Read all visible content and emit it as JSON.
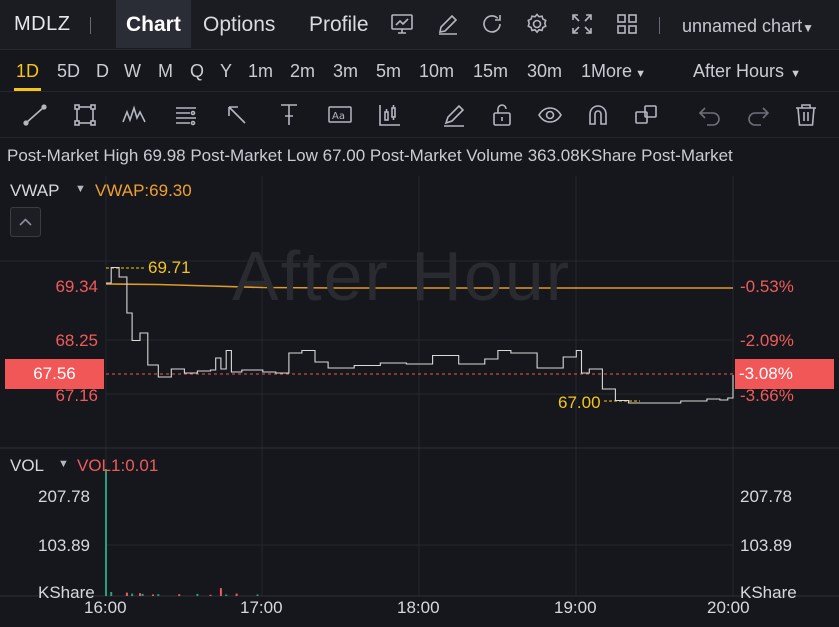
{
  "header": {
    "symbol": "MDLZ",
    "tabs": [
      {
        "label": "Chart",
        "active": true
      },
      {
        "label": "Options",
        "active": false
      },
      {
        "label": "Profile",
        "active": false
      }
    ],
    "icons": [
      "monitor-chart-icon",
      "pen-edit-icon",
      "refresh-icon",
      "gear-icon",
      "fullscreen-icon",
      "grid-layout-icon"
    ],
    "chart_name": "unnamed chart"
  },
  "periods": {
    "items": [
      "1D",
      "5D",
      "D",
      "W",
      "M",
      "Q",
      "Y",
      "1m",
      "2m",
      "3m",
      "5m",
      "10m",
      "15m",
      "30m"
    ],
    "active": "1D",
    "more_label": "1More",
    "session_label": "After Hours"
  },
  "toolbar": {
    "tools": [
      "trend-line-icon",
      "rectangle-icon",
      "pattern-wave-icon",
      "fibonacci-icon",
      "arrow-icon",
      "measure-icon",
      "text-note-icon",
      "candle-icon",
      "brush-icon",
      "unlock-icon",
      "eye-icon",
      "magnet-icon",
      "copy-layers-icon",
      "undo-icon",
      "redo-icon",
      "trash-icon"
    ]
  },
  "stats": {
    "high_label": "Post-Market High",
    "high_value": "69.98",
    "low_label": "Post-Market Low",
    "low_value": "67.00",
    "volume_label": "Post-Market Volume",
    "volume_value": "363.08KShare",
    "trailing_label": "Post-Market"
  },
  "price_panel": {
    "indicator_name": "VWAP",
    "indicator_value": "VWAP:69.30",
    "watermark": "After Hour",
    "left_ticks": [
      {
        "label": "69.34",
        "value": 69.34
      },
      {
        "label": "68.25",
        "value": 68.25
      },
      {
        "label": "67.16",
        "value": 67.16
      }
    ],
    "right_ticks": [
      "-0.53%",
      "-2.09%",
      "-3.66%"
    ],
    "current_price": "67.56",
    "current_change": "-3.08%",
    "high_annotation": "69.71",
    "low_annotation": "67.00"
  },
  "volume_panel": {
    "indicator_name": "VOL",
    "indicator_value": "VOL1:0.01",
    "top_tick": "207.78",
    "mid_tick": "103.89",
    "unit": "KShare"
  },
  "x_axis": {
    "labels": [
      "16:00",
      "17:00",
      "18:00",
      "19:00",
      "20:00"
    ]
  },
  "colors": {
    "accent": "#f5c518",
    "down": "#ef5b5b",
    "up": "#26a17b",
    "vwap_line": "#e09a2a",
    "price_line": "#d9d9d9"
  },
  "chart_data": {
    "type": "line",
    "x_range": [
      "16:00",
      "20:00"
    ],
    "ylim": [
      66.9,
      70.1
    ],
    "series": [
      {
        "name": "VWAP",
        "points": [
          [
            "16:00",
            69.38
          ],
          [
            "16:20",
            69.37
          ],
          [
            "16:40",
            69.34
          ],
          [
            "17:00",
            69.31
          ],
          [
            "17:30",
            69.3
          ],
          [
            "18:00",
            69.3
          ],
          [
            "18:30",
            69.3
          ],
          [
            "19:00",
            69.3
          ],
          [
            "19:30",
            69.3
          ],
          [
            "20:00",
            69.3
          ]
        ]
      },
      {
        "points": [
          [
            "16:00",
            69.4
          ],
          [
            "16:02",
            69.71
          ],
          [
            "16:05",
            69.52
          ],
          [
            "16:08",
            68.8
          ],
          [
            "16:10",
            68.25
          ],
          [
            "16:13",
            68.4
          ],
          [
            "16:16",
            67.76
          ],
          [
            "16:20",
            67.52
          ],
          [
            "16:25",
            67.68
          ],
          [
            "16:30",
            67.6
          ],
          [
            "16:35",
            67.64
          ],
          [
            "16:40",
            67.66
          ],
          [
            "16:42",
            67.9
          ],
          [
            "16:44",
            67.68
          ],
          [
            "16:46",
            68.05
          ],
          [
            "16:48",
            67.62
          ],
          [
            "16:52",
            67.66
          ],
          [
            "17:00",
            67.62
          ],
          [
            "17:05",
            67.6
          ],
          [
            "17:10",
            68.0
          ],
          [
            "17:15",
            68.05
          ],
          [
            "17:20",
            67.82
          ],
          [
            "17:25",
            67.7
          ],
          [
            "17:35",
            67.75
          ],
          [
            "17:45",
            67.8
          ],
          [
            "17:55",
            67.78
          ],
          [
            "18:05",
            67.95
          ],
          [
            "18:15",
            67.78
          ],
          [
            "18:25",
            67.88
          ],
          [
            "18:30",
            68.05
          ],
          [
            "18:35",
            68.0
          ],
          [
            "18:45",
            67.7
          ],
          [
            "18:55",
            67.92
          ],
          [
            "19:00",
            68.05
          ],
          [
            "19:02",
            67.6
          ],
          [
            "19:05",
            67.68
          ],
          [
            "19:10",
            67.28
          ],
          [
            "19:15",
            67.05
          ],
          [
            "19:20",
            67.0
          ],
          [
            "19:30",
            67.0
          ],
          [
            "19:40",
            67.04
          ],
          [
            "19:50",
            67.08
          ],
          [
            "19:55",
            67.06
          ],
          [
            "19:58",
            67.1
          ],
          [
            "20:00",
            67.56
          ]
        ]
      }
    ],
    "volume": {
      "ylim": [
        0,
        207.78
      ],
      "up_bars": [
        [
          "16:00",
          207.78
        ],
        [
          "16:02",
          6.5
        ],
        [
          "16:10",
          4.0
        ],
        [
          "16:14",
          3.5
        ],
        [
          "16:20",
          3.0
        ],
        [
          "16:35",
          3.5
        ],
        [
          "16:46",
          2.5
        ],
        [
          "16:58",
          2.5
        ]
      ],
      "down_bars": [
        [
          "16:08",
          5.5
        ],
        [
          "16:13",
          4.5
        ],
        [
          "16:18",
          2.5
        ],
        [
          "16:28",
          3.0
        ],
        [
          "16:40",
          2.0
        ],
        [
          "16:44",
          13.0
        ],
        [
          "16:50",
          4.0
        ]
      ]
    }
  }
}
